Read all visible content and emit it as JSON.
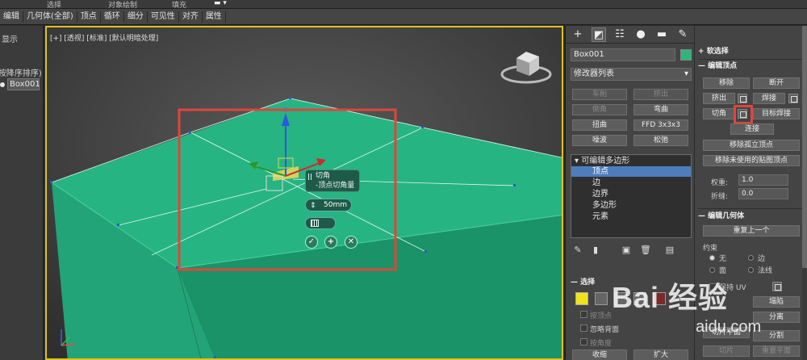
{
  "menubar": {
    "items": [
      "选择",
      "对象绘制",
      "填充"
    ]
  },
  "toolbar": {
    "items": [
      "编辑",
      "几何体(全部)",
      "顶点",
      "循环",
      "细分",
      "可见性",
      "对齐",
      "属性"
    ]
  },
  "scene_explorer": {
    "line1": "显示",
    "line2": "(按降序排序)",
    "object_label": "Box001"
  },
  "viewport": {
    "label": "[+] [透视] [标准] [默认明暗处理]",
    "caddy": {
      "title": "切角",
      "subtitle": "-顶点切角量",
      "value": "50mm",
      "ok_symbol": "✓",
      "apply_symbol": "+",
      "cancel_symbol": "✕"
    }
  },
  "modify_panel": {
    "object_name": "Box001",
    "object_color": "#2db57c",
    "modifier_list": "修改器列表",
    "buttons": [
      {
        "label": "车削",
        "disabled": true
      },
      {
        "label": "挤出",
        "disabled": true
      },
      {
        "label": "倒角",
        "disabled": true
      },
      {
        "label": "弯曲",
        "disabled": false
      },
      {
        "label": "扭曲",
        "disabled": false
      },
      {
        "label": "FFD 3x3x3",
        "disabled": false
      },
      {
        "label": "噪波",
        "disabled": false
      },
      {
        "label": "松弛",
        "disabled": false
      }
    ],
    "stack": {
      "root": "可编辑多边形",
      "items": [
        "顶点",
        "边",
        "边界",
        "多边形",
        "元素"
      ],
      "selected": "顶点"
    },
    "select_rollout": {
      "title": "选择",
      "opt1": "按顶点",
      "opt2": "忽略背面",
      "opt3": "按角度",
      "shrink": "收缩",
      "grow": "扩大"
    }
  },
  "edit_rollout": {
    "soft_select": "软选择",
    "edit_vertices": "编辑顶点",
    "remove": "移除",
    "break": "断开",
    "extrude": "挤出",
    "weld": "焊接",
    "chamfer": "切角",
    "target_weld": "目标焊接",
    "connect": "连接",
    "remove_isolated": "移除孤立顶点",
    "remove_unused_map": "移除未使用的贴图顶点",
    "weight_label": "权重:",
    "weight_value": "1.0",
    "crease_label": "折缝:",
    "crease_value": "0.0",
    "edit_geometry": "编辑几何体",
    "repeat_last": "重复上一个",
    "constraints": "约束",
    "c_none": "无",
    "c_edge": "边",
    "c_face": "面",
    "c_normal": "法线",
    "preserve_uv": "保持 UV",
    "collapse": "塌陷",
    "detach": "分离",
    "slice_plane": "切片平面",
    "split": "分割",
    "slice": "切片",
    "reset_plane": "重置平面"
  },
  "watermark": {
    "text": "Bai 经验",
    "url_text": "aidu.com"
  },
  "colors": {
    "box_top": "#27b483",
    "box_front": "#23a478",
    "box_side": "#188964",
    "highlight_rect": "#e0453c",
    "viewport_border": "#e0c21c"
  }
}
